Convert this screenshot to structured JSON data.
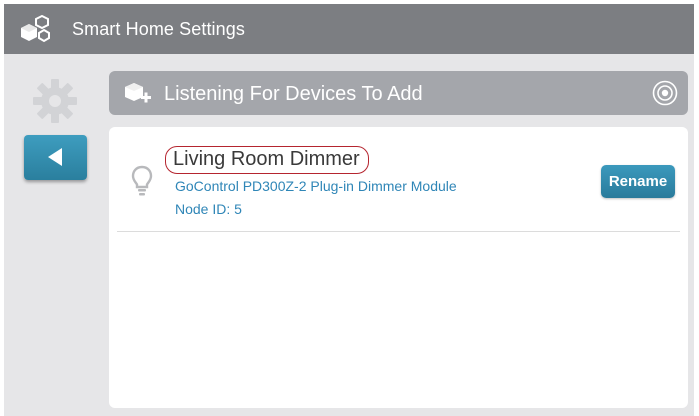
{
  "header": {
    "logo_icon": "smart-home-cubes-icon",
    "title": "Smart Home Settings"
  },
  "sidebar": {
    "settings_icon": "gear-icon",
    "back_icon": "back-arrow-icon"
  },
  "listening_bar": {
    "icon": "add-device-icon",
    "label": "Listening For Devices To Add",
    "status_icon": "target-icon"
  },
  "devices": [
    {
      "icon": "lightbulb-icon",
      "name": "Living Room Dimmer",
      "model": "GoControl PD300Z-2 Plug-in Dimmer Module",
      "node": "Node ID: 5",
      "rename_label": "Rename"
    }
  ],
  "colors": {
    "header_bg": "#7c7e82",
    "background": "#e6e6e8",
    "accent_blue": "#2f86b7",
    "highlight_outline": "#b5252f",
    "listen_bar_bg": "#a4a6ab"
  }
}
